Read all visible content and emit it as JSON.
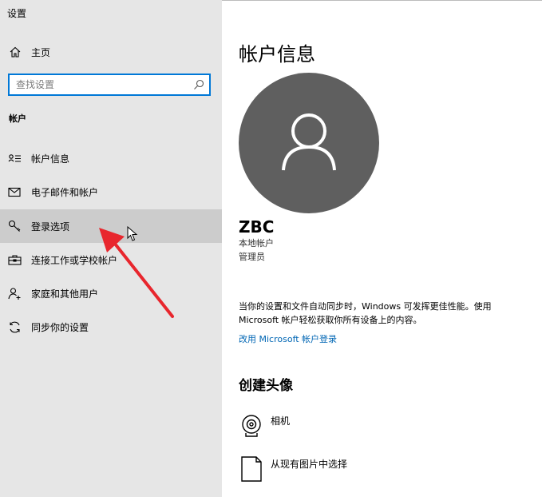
{
  "app_title": "设置",
  "home": {
    "label": "主页",
    "icon": "home-icon"
  },
  "search": {
    "placeholder": "查找设置",
    "value": "",
    "icon": "search-icon"
  },
  "section_title": "帐户",
  "nav": [
    {
      "label": "帐户信息",
      "icon": "person-card-icon",
      "selected": false
    },
    {
      "label": "电子邮件和帐户",
      "icon": "mail-icon",
      "selected": false
    },
    {
      "label": "登录选项",
      "icon": "key-icon",
      "selected": true
    },
    {
      "label": "连接工作或学校帐户",
      "icon": "briefcase-icon",
      "selected": false
    },
    {
      "label": "家庭和其他用户",
      "icon": "person-add-icon",
      "selected": false
    },
    {
      "label": "同步你的设置",
      "icon": "sync-icon",
      "selected": false
    }
  ],
  "main": {
    "page_title": "帐户信息",
    "user": {
      "name": "ZBC",
      "account_type": "本地帐户",
      "role": "管理员"
    },
    "sync_text": "当你的设置和文件自动同步时，Windows 可发挥更佳性能。使用 Microsoft 帐户轻松获取你所有设备上的内容。",
    "ms_link": "改用 Microsoft 帐户登录",
    "create_avatar_title": "创建头像",
    "options": [
      {
        "label": "相机",
        "icon": "webcam-icon"
      },
      {
        "label": "从现有图片中选择",
        "icon": "picture-file-icon"
      }
    ]
  },
  "colors": {
    "sidebar_bg": "#e6e6e6",
    "selected_bg": "#cccccc",
    "accent": "#0078d7",
    "link": "#0066b4",
    "avatar_bg": "#5f5f5f",
    "annotation_arrow": "#e8262d"
  }
}
